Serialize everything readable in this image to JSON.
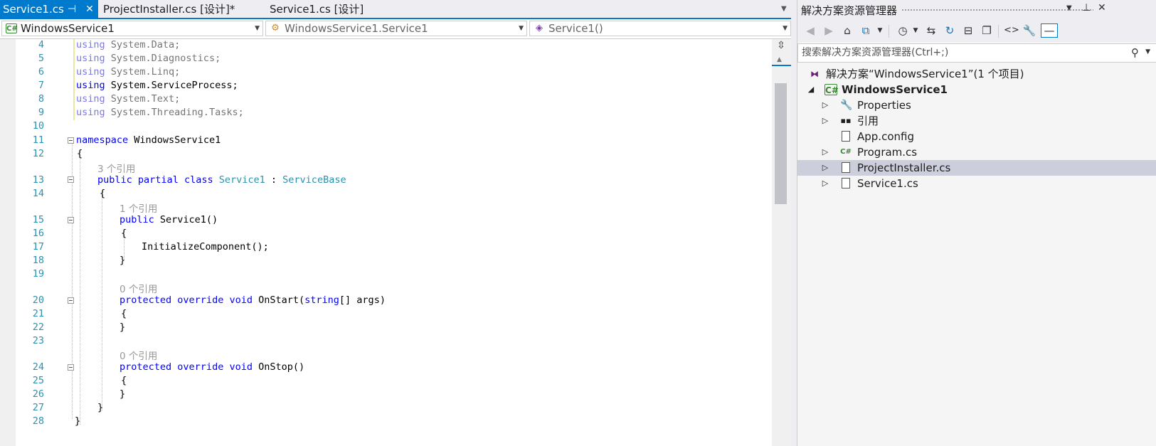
{
  "tabs": [
    {
      "label": "Service1.cs",
      "active": true,
      "pin_icon": "pin-icon",
      "close_icon": "close-icon"
    },
    {
      "label": "ProjectInstaller.cs [设计]*",
      "active": false
    },
    {
      "label": "Service1.cs [设计]",
      "active": false
    }
  ],
  "navbar": {
    "project": "WindowsService1",
    "type": "WindowsService1.Service1",
    "member": "Service1()"
  },
  "editor": {
    "line_numbers": [
      "4",
      "5",
      "6",
      "7",
      "8",
      "9",
      "10",
      "11",
      "12",
      "13",
      "14",
      "15",
      "16",
      "17",
      "18",
      "19",
      "20",
      "21",
      "22",
      "23",
      "24",
      "25",
      "26",
      "27",
      "28"
    ],
    "lines": {
      "l4_kw": "using",
      "l4_rest": " System.Data;",
      "l5_kw": "using",
      "l5_rest": " System.Diagnostics;",
      "l6_kw": "using",
      "l6_rest": " System.Linq;",
      "l7_kw": "using",
      "l7_rest": " System.ServiceProcess;",
      "l8_kw": "using",
      "l8_rest": " System.Text;",
      "l9_kw": "using",
      "l9_rest": " System.Threading.Tasks;",
      "l11_kw": "namespace",
      "l11_rest": " WindowsService1",
      "l12": "{",
      "lens13": "3 个引用",
      "l13_kw1": "public",
      "l13_kw2": "partial",
      "l13_kw3": "class",
      "l13_type": "Service1",
      "l13_colon": " : ",
      "l13_base": "ServiceBase",
      "l14": "{",
      "lens15": "1 个引用",
      "l15_kw": "public",
      "l15_rest": " Service1()",
      "l16": "{",
      "l17": "InitializeComponent();",
      "l18": "}",
      "lens20": "0 个引用",
      "l20_kw1": "protected",
      "l20_kw2": "override",
      "l20_kw3": "void",
      "l20_name": " OnStart(",
      "l20_kw4": "string",
      "l20_rest": "[] args)",
      "l21": "{",
      "l22": "}",
      "lens24": "0 个引用",
      "l24_kw1": "protected",
      "l24_kw2": "override",
      "l24_kw3": "void",
      "l24_rest": " OnStop()",
      "l25": "{",
      "l26": "}",
      "l27": "}",
      "l28": "}"
    },
    "split_icon": "split-icon"
  },
  "solution_explorer": {
    "title": "解决方案资源管理器",
    "title_icons": [
      "chevron-down-icon",
      "pin-icon",
      "close-icon"
    ],
    "toolbar_icons": [
      "back-icon",
      "forward-icon",
      "home-icon",
      "switch-views-icon",
      "pending-changes-icon",
      "sync-icon",
      "refresh-icon",
      "collapse-all-icon",
      "show-all-files-icon",
      "view-code-icon",
      "properties-icon",
      "preview-icon"
    ],
    "search_placeholder": "搜索解决方案资源管理器(Ctrl+;)",
    "tree": {
      "solution": "解决方案“WindowsService1”(1 个项目)",
      "project": "WindowsService1",
      "properties": "Properties",
      "references": "引用",
      "appconfig": "App.config",
      "program": "Program.cs",
      "projectinstaller": "ProjectInstaller.cs",
      "service1": "Service1.cs"
    },
    "badge_cs": "C#"
  },
  "colors": {
    "accent": "#007acc",
    "keyword": "#0000ff",
    "type": "#2b91af",
    "line_number": "#2b91af",
    "selection": "#cccedb"
  }
}
